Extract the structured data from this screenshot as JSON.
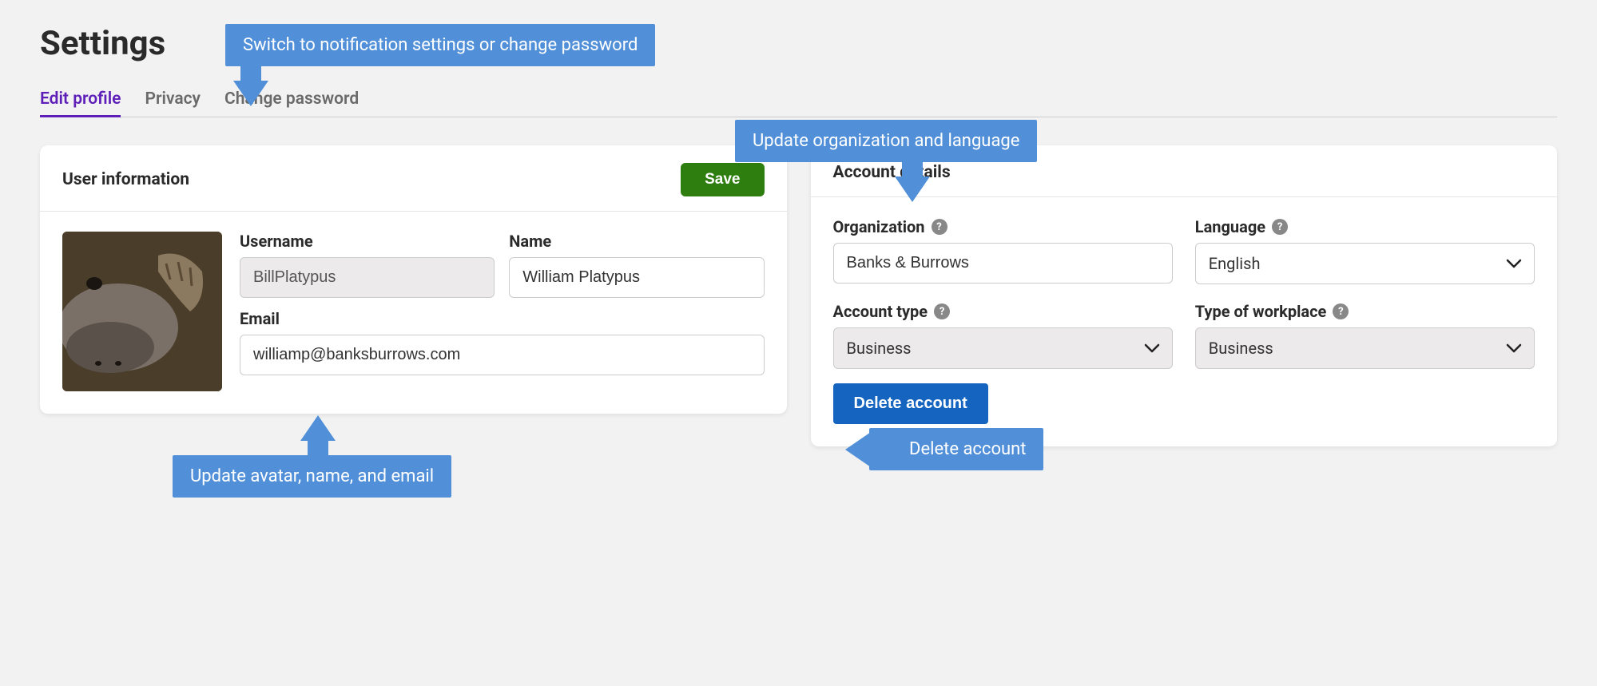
{
  "page": {
    "title": "Settings"
  },
  "tabs": {
    "edit_profile": "Edit profile",
    "privacy": "Privacy",
    "change_password": "Change password"
  },
  "user_info": {
    "card_title": "User information",
    "save_label": "Save",
    "username_label": "Username",
    "username_value": "BillPlatypus",
    "name_label": "Name",
    "name_value": "William Platypus",
    "email_label": "Email",
    "email_value": "williamp@banksburrows.com"
  },
  "account_details": {
    "card_title": "Account details",
    "organization_label": "Organization",
    "organization_value": "Banks & Burrows",
    "language_label": "Language",
    "language_value": "English",
    "account_type_label": "Account type",
    "account_type_value": "Business",
    "workplace_label": "Type of workplace",
    "workplace_value": "Business",
    "delete_label": "Delete account"
  },
  "callouts": {
    "tabs": "Switch to notification settings or change password",
    "org_lang": "Update organization and language",
    "avatar": "Update avatar, name, and email",
    "delete": "Delete account"
  },
  "help_glyph": "?"
}
